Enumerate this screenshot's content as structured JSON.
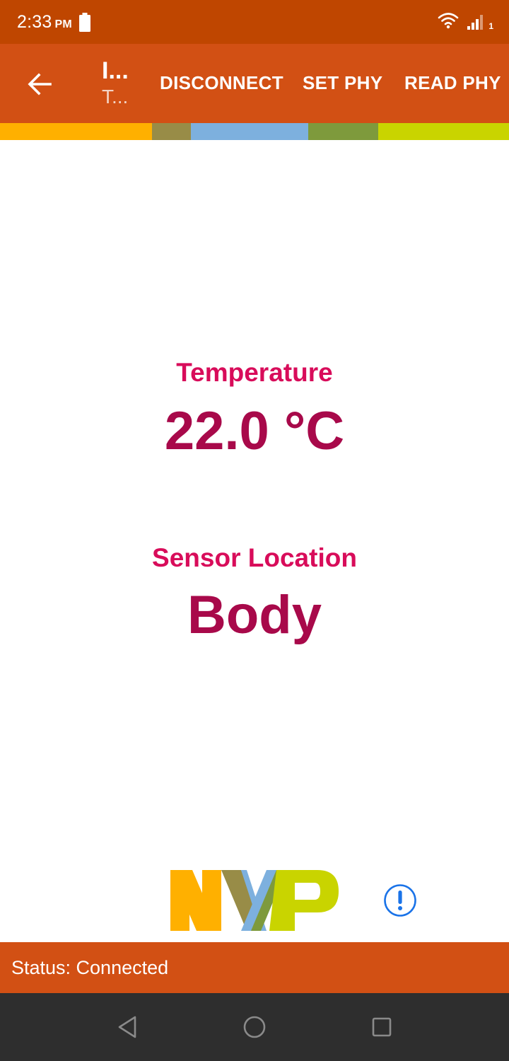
{
  "status_bar": {
    "time": "2:33",
    "ampm": "PM",
    "icons": [
      "battery-icon",
      "wifi-icon",
      "signal-icon"
    ],
    "sim_slot": "1"
  },
  "app_bar": {
    "back_icon": "arrow-left-icon",
    "title": "I...",
    "subtitle": "T...",
    "actions": {
      "disconnect": "DISCONNECT",
      "set_phy": "SET PHY",
      "read_phy": "READ PHY"
    }
  },
  "main": {
    "temperature_label": "Temperature",
    "temperature_value": "22.0 °C",
    "location_label": "Sensor Location",
    "location_value": "Body"
  },
  "footer": {
    "logo": "NXP",
    "info_icon": "info-icon",
    "status": "Status: Connected"
  },
  "nav": {
    "icons": [
      "back-triangle-icon",
      "home-circle-icon",
      "recents-square-icon"
    ]
  },
  "colors": {
    "status_bar": "#bf4600",
    "app_bar": "#d25014",
    "label": "#d80c5a",
    "value": "#a8094a",
    "stripe": [
      "#ffb000",
      "#988c47",
      "#7db0de",
      "#7e9a3c",
      "#c9d400"
    ]
  }
}
